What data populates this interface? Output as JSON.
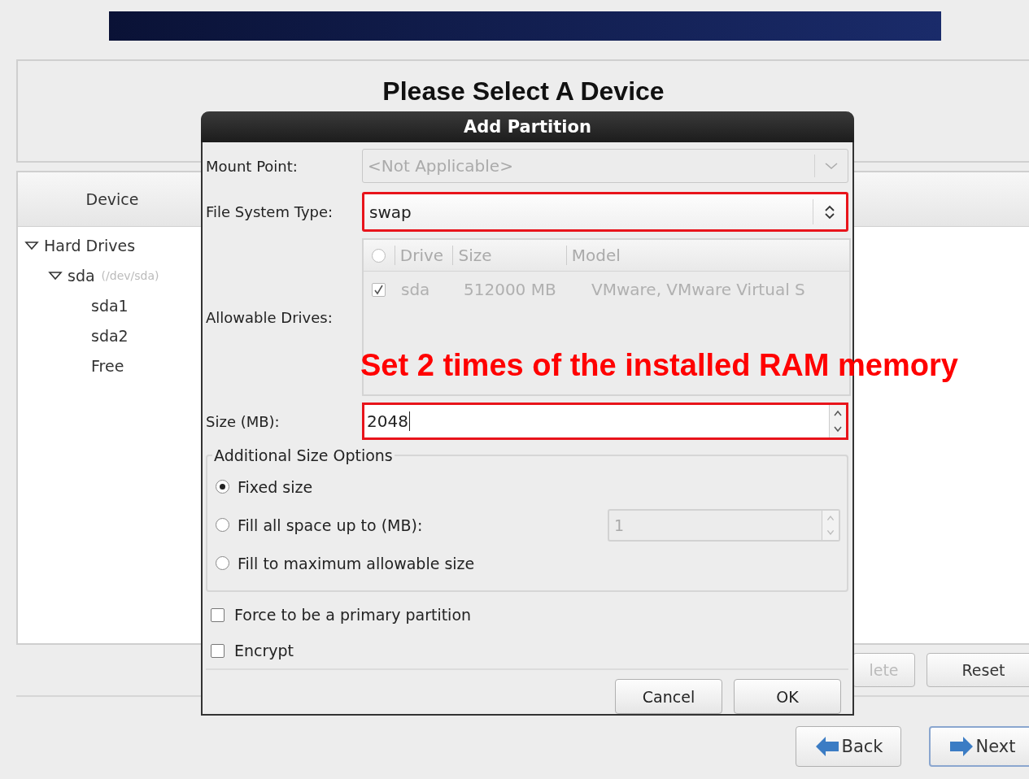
{
  "page": {
    "title": "Please Select A Device",
    "tree_header": "Device",
    "tree": [
      {
        "label": "Hard Drives",
        "expanded": true,
        "children": [
          {
            "label": "sda",
            "detail": "(/dev/sda)",
            "expanded": true,
            "children": [
              {
                "label": "sda1"
              },
              {
                "label": "sda2"
              },
              {
                "label": "Free"
              }
            ]
          }
        ]
      }
    ],
    "buttons": [
      {
        "label": "lete",
        "disabled": true
      },
      {
        "label": "Reset",
        "disabled": false
      }
    ],
    "nav_buttons": [
      {
        "label": "Back",
        "kind": "back"
      },
      {
        "label": "Next",
        "kind": "next"
      }
    ]
  },
  "dialog": {
    "title": "Add Partition",
    "mount_point": {
      "label": "Mount Point:",
      "value": "<Not Applicable>",
      "disabled": true
    },
    "file_system_type": {
      "label": "File System Type:",
      "value": "swap",
      "highlighted": true
    },
    "allowable_drives": {
      "label": "Allowable Drives:",
      "disabled": true,
      "columns": [
        "Drive",
        "Size",
        "Model"
      ],
      "rows": [
        {
          "checked": true,
          "drive": "sda",
          "size": "512000 MB",
          "model": "VMware, VMware Virtual S"
        }
      ]
    },
    "size": {
      "label": "Size (MB):",
      "value": "2048",
      "highlighted": true
    },
    "size_options": {
      "legend": "Additional Size Options",
      "options": [
        {
          "label": "Fixed size",
          "selected": true
        },
        {
          "label": "Fill all space up to (MB):",
          "selected": false,
          "spin_value": "1"
        },
        {
          "label": "Fill to maximum allowable size",
          "selected": false
        }
      ]
    },
    "checkboxes": [
      {
        "label": "Force to be a primary partition",
        "checked": false
      },
      {
        "label": "Encrypt",
        "checked": false
      }
    ],
    "buttons": [
      "Cancel",
      "OK"
    ]
  },
  "annotation": {
    "text": "Set 2 times of the installed RAM memory"
  }
}
